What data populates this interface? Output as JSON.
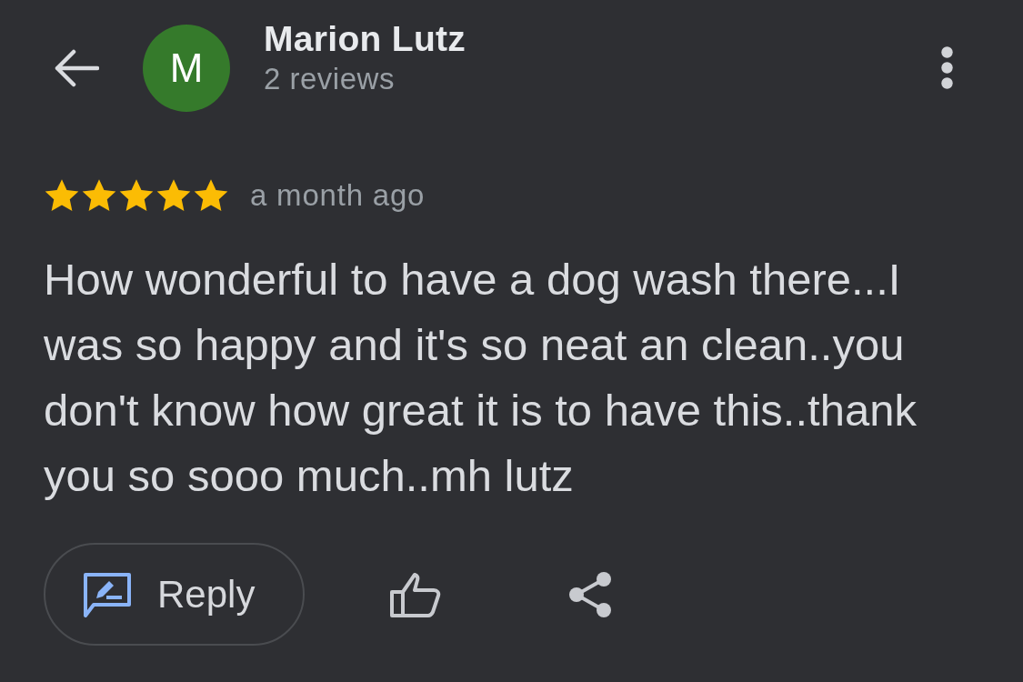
{
  "header": {
    "avatar_initial": "M",
    "name": "Marion Lutz",
    "review_count": "2 reviews"
  },
  "review": {
    "stars": 5,
    "time": "a month ago",
    "text": "How wonderful to have a dog wash there...I was so happy and it's so neat an clean..you don't know how great it is to have this..thank you so sooo much..mh lutz"
  },
  "actions": {
    "reply": "Reply"
  }
}
